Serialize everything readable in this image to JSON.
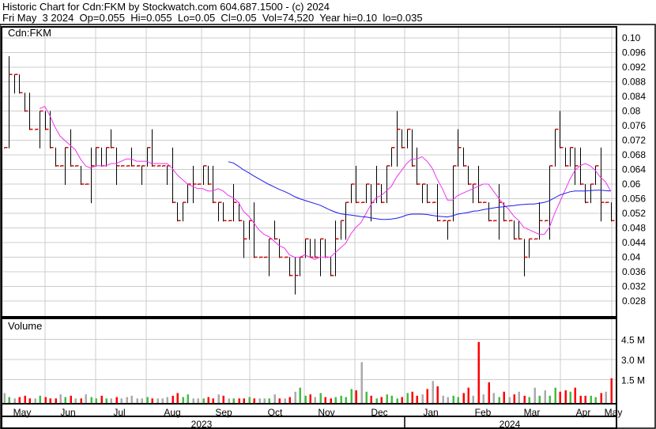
{
  "header": {
    "title": "Historic Chart for Cdn:FKM by Stockwatch.com 604.687.1500 - (c) 2024",
    "quote": "Fri May  3 2024  Op=0.055  Hi=0.055  Lo=0.05  Cl=0.05  Vol=74,520  Year hi=0.10  lo=0.035"
  },
  "chart_data": {
    "type": "line",
    "symbol_label": "Cdn:FKM",
    "volume_label": "Volume",
    "price_ticks": [
      "0.10",
      "0.096",
      "0.092",
      "0.088",
      "0.084",
      "0.08",
      "0.076",
      "0.072",
      "0.068",
      "0.064",
      "0.06",
      "0.056",
      "0.052",
      "0.048",
      "0.044",
      "0.04",
      "0.036",
      "0.032",
      "0.028"
    ],
    "ylim": [
      0.0255,
      0.1025
    ],
    "volume_ticks": [
      "4.5 M",
      "3.0 M",
      "1.5 M"
    ],
    "volume_tick_values": [
      4.5,
      3.0,
      1.5
    ],
    "months": [
      "May",
      "Jun",
      "Jul",
      "Aug",
      "Sep",
      "Oct",
      "Nov",
      "Dec",
      "Jan",
      "Feb",
      "Mar",
      "Apr",
      "May"
    ],
    "years": [
      "2023",
      "2024"
    ],
    "close": [
      0.07,
      0.09,
      0.09,
      0.085,
      0.08,
      0.075,
      0.075,
      0.08,
      0.075,
      0.07,
      0.065,
      0.065,
      0.07,
      0.065,
      0.065,
      0.06,
      0.06,
      0.065,
      0.07,
      0.065,
      0.07,
      0.07,
      0.065,
      0.065,
      0.065,
      0.065,
      0.065,
      0.065,
      0.07,
      0.065,
      0.065,
      0.065,
      0.065,
      0.055,
      0.05,
      0.055,
      0.06,
      0.06,
      0.06,
      0.065,
      0.06,
      0.055,
      0.055,
      0.05,
      0.05,
      0.055,
      0.05,
      0.045,
      0.05,
      0.04,
      0.04,
      0.04,
      0.045,
      0.045,
      0.04,
      0.04,
      0.035,
      0.035,
      0.04,
      0.045,
      0.04,
      0.04,
      0.045,
      0.04,
      0.035,
      0.045,
      0.05,
      0.055,
      0.06,
      0.055,
      0.055,
      0.06,
      0.055,
      0.06,
      0.055,
      0.065,
      0.07,
      0.075,
      0.07,
      0.075,
      0.065,
      0.06,
      0.06,
      0.055,
      0.055,
      0.05,
      0.05,
      0.05,
      0.065,
      0.07,
      0.065,
      0.06,
      0.06,
      0.055,
      0.055,
      0.05,
      0.05,
      0.055,
      0.05,
      0.05,
      0.045,
      0.045,
      0.04,
      0.045,
      0.045,
      0.05,
      0.05,
      0.065,
      0.075,
      0.07,
      0.065,
      0.07,
      0.065,
      0.06,
      0.055,
      0.06,
      0.065,
      0.055,
      0.055,
      0.05
    ],
    "volume_m": [
      0.5,
      0.2,
      0.1,
      0.2,
      0.3,
      0.1,
      0.1,
      0.3,
      0.2,
      0.1,
      0.1,
      0.4,
      0.2,
      0.3,
      0.1,
      0.1,
      0.4,
      0.2,
      0.1,
      0.3,
      0.1,
      0.1,
      0.2,
      0.1,
      0.2,
      0.3,
      0.1,
      0.1,
      0.2,
      0.1,
      0.1,
      0.1,
      0.2,
      0.3,
      0.5,
      0.2,
      0.4,
      0.1,
      0.1,
      0.1,
      0.2,
      0.1,
      0.4,
      0.3,
      0.1,
      0.1,
      0.1,
      0.1,
      0.2,
      0.1,
      0.1,
      0.1,
      0.1,
      0.4,
      0.1,
      0.1,
      0.2,
      0.6,
      0.9,
      0.3,
      0.4,
      0.2,
      0.5,
      0.2,
      0.1,
      0.2,
      0.3,
      0.2,
      0.8,
      0.7,
      2.8,
      0.6,
      0.3,
      0.1,
      0.2,
      0.4,
      0.3,
      0.1,
      0.2,
      0.5,
      0.6,
      0.3,
      0.4,
      0.8,
      1.4,
      1.0,
      0.3,
      0.2,
      0.3,
      0.2,
      0.5,
      0.9,
      0.3,
      4.3,
      0.4,
      1.3,
      0.5,
      0.2,
      0.6,
      0.2,
      0.4,
      0.6,
      0.3,
      0.2,
      0.9,
      0.3,
      0.7,
      0.3,
      0.9,
      0.6,
      0.7,
      0.6,
      0.9,
      0.3,
      0.3,
      0.3,
      0.2,
      0.5,
      0.6,
      1.6,
      0.7,
      0.1
    ],
    "ma_short_window": 20,
    "ma_long_window": 50
  },
  "colors": {
    "up": "#44bb44",
    "down": "#ff0000",
    "flat": "#aaaaaa",
    "ma_short": "#ee33ee",
    "ma_long": "#1a1aee",
    "close_tick": "#dd0000",
    "grid": "#cccccc"
  }
}
